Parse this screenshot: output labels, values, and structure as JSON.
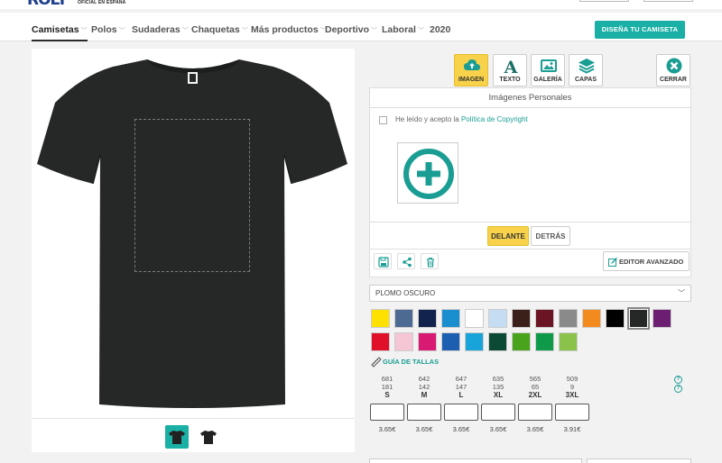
{
  "header": {
    "logo_text": "ROLY",
    "logo_sub": "OFICIAL EN ESPAÑA"
  },
  "nav": {
    "items": [
      {
        "label": "Camisetas",
        "chev": "﹀"
      },
      {
        "label": "Polos",
        "chev": "﹀"
      },
      {
        "label": "Sudaderas",
        "chev": "﹀"
      },
      {
        "label": "Chaquetas",
        "chev": "﹀"
      },
      {
        "label": "Más productos",
        "chev": "﹀"
      },
      {
        "label": "Deportivo",
        "chev": "﹀"
      },
      {
        "label": "Laboral",
        "chev": "﹀"
      },
      {
        "label": "2020",
        "chev": ""
      }
    ],
    "design_button": "DISEÑA TU CAMISETA"
  },
  "product": {
    "shirt_color": "#262828"
  },
  "tools": {
    "image": "IMAGEN",
    "text": "TEXTO",
    "gallery": "GALERÍA",
    "layers": "CAPAS",
    "close": "CERRAR"
  },
  "panel": {
    "title": "Imágenes Personales",
    "copyright_text": "He leído y acepto la ",
    "copyright_link": "Política de Copyright",
    "front": "DELANTE",
    "back": "DETRÁS",
    "editor": "EDITOR AVANZADO"
  },
  "color_select": {
    "value": "PLOMO OSCURO"
  },
  "colors": [
    "#ffe100",
    "#4d6a93",
    "#12244d",
    "#1a8fd0",
    "#ffffff",
    "#c4ddf3",
    "#3b1f19",
    "#6a1424",
    "#8a8a8a",
    "#f28a1e",
    "#000000",
    "#262828",
    "#6c1f72",
    "#e0102b",
    "#f5c6d4",
    "#d81a72",
    "#1c5eb0",
    "#18a3d9",
    "#0d4a36",
    "#4aa31c",
    "#0f9a4a",
    "#8bc34a"
  ],
  "selected_color_index": 11,
  "size_guide": "GUÍA DE TALLAS",
  "sizes": [
    {
      "size": "S",
      "stock1": "681",
      "stock2": "181",
      "price": "3.65€"
    },
    {
      "size": "M",
      "stock1": "642",
      "stock2": "142",
      "price": "3.65€"
    },
    {
      "size": "L",
      "stock1": "647",
      "stock2": "147",
      "price": "3.65€"
    },
    {
      "size": "XL",
      "stock1": "635",
      "stock2": "135",
      "price": "3.65€"
    },
    {
      "size": "2XL",
      "stock1": "565",
      "stock2": "65",
      "price": "3.65€"
    },
    {
      "size": "3XL",
      "stock1": "509",
      "stock2": "9",
      "price": "3.91€"
    }
  ],
  "help_icons": [
    "?",
    "?"
  ]
}
